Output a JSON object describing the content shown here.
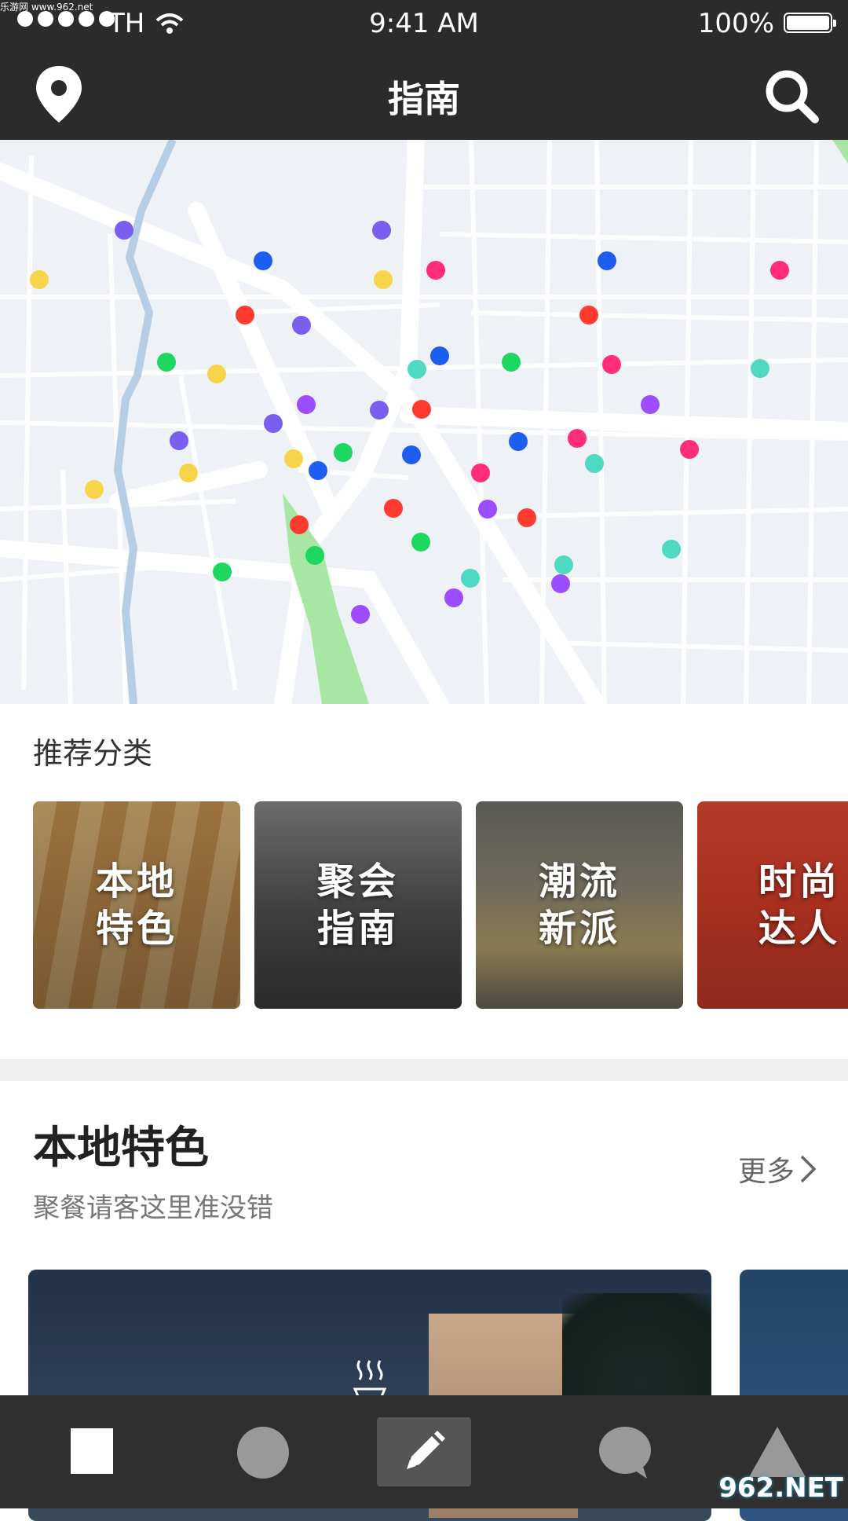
{
  "status_bar": {
    "carrier": "TH",
    "time": "9:41 AM",
    "battery": "100%",
    "watermark": "乐游网 www.962.net"
  },
  "nav": {
    "title": "指南",
    "left_icon": "location-pin-icon",
    "right_icon": "search-icon"
  },
  "map": {
    "pin_colors": [
      "#ff3b30",
      "#1d5ef0",
      "#7a5ef0",
      "#f7d44a",
      "#1ed760",
      "#ff2d7a",
      "#4dd9c2",
      "#9b4dff"
    ]
  },
  "recommend": {
    "title": "推荐分类",
    "categories": [
      {
        "line1": "本地",
        "line2": "特色"
      },
      {
        "line1": "聚会",
        "line2": "指南"
      },
      {
        "line1": "潮流",
        "line2": "新派"
      },
      {
        "line1": "时尚",
        "line2": "达人"
      }
    ]
  },
  "local_feature": {
    "title": "本地特色",
    "subtitle": "聚餐请客这里准没错",
    "more_label": "更多"
  },
  "tab_bar": {
    "tabs": [
      "square-icon",
      "circle-icon",
      "pencil-icon",
      "chat-bubble-icon",
      "triangle-icon"
    ]
  },
  "corner_watermark": "962.NET"
}
